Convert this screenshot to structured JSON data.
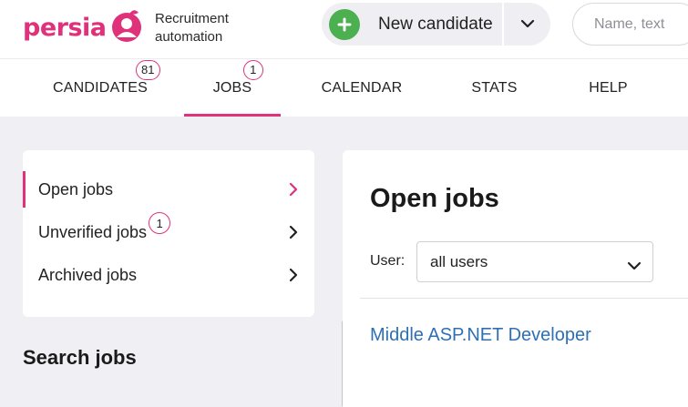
{
  "brand": {
    "logo_text": "persia",
    "tagline_line1": "Recruitment",
    "tagline_line2": "automation",
    "accent": "#e0317b"
  },
  "header": {
    "new_candidate_label": "New candidate",
    "plus_icon": "plus-icon",
    "dropdown_icon": "chevron-down-icon",
    "search_placeholder": "Name, text"
  },
  "nav": {
    "tabs": [
      {
        "label": "CANDIDATES",
        "badge": "81"
      },
      {
        "label": "JOBS",
        "badge": "1",
        "active": true
      },
      {
        "label": "CALENDAR"
      },
      {
        "label": "STATS"
      },
      {
        "label": "HELP"
      }
    ]
  },
  "sidebar": {
    "items": [
      {
        "label": "Open jobs",
        "active": true
      },
      {
        "label": "Unverified jobs",
        "badge": "1"
      },
      {
        "label": "Archived jobs"
      }
    ],
    "search_heading": "Search jobs"
  },
  "main": {
    "title": "Open jobs",
    "user_label": "User:",
    "user_select_value": "all users",
    "jobs": [
      "Middle ASP.NET Developer"
    ]
  }
}
